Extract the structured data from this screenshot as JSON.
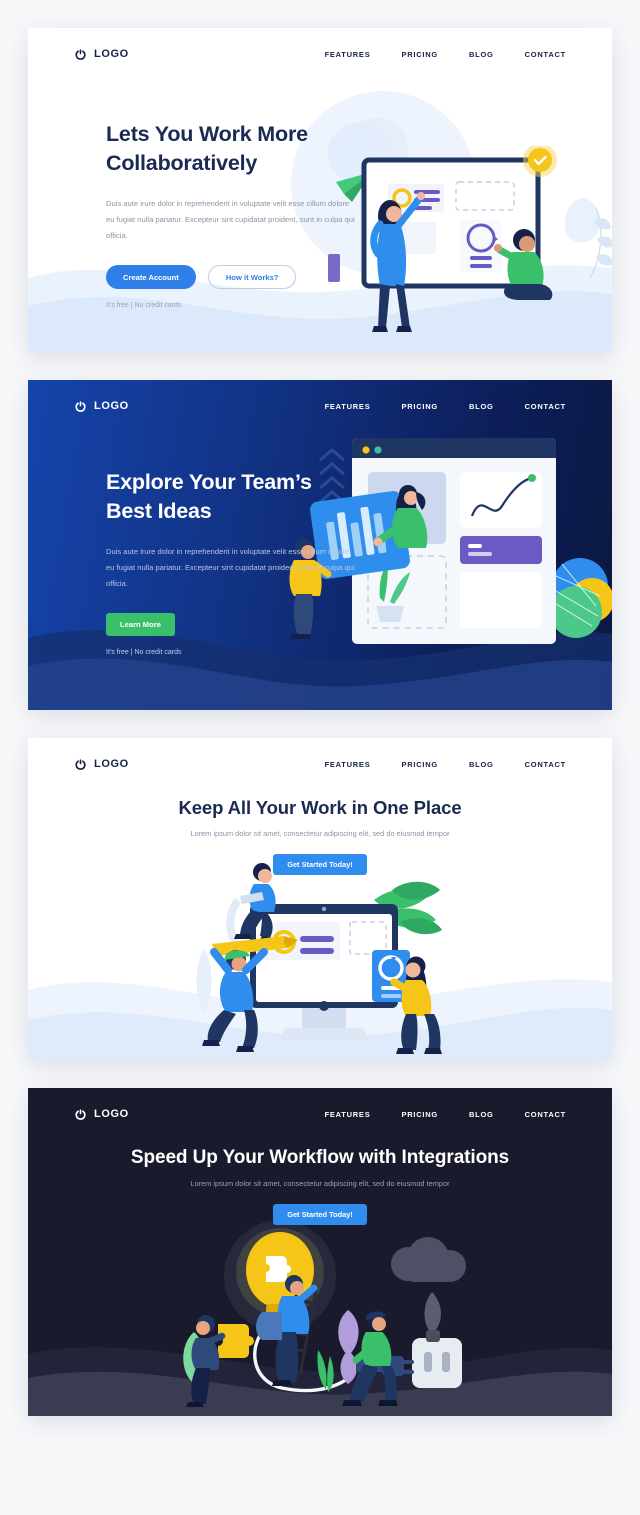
{
  "brand": {
    "name": "LOGO",
    "icon": "power-refresh-icon"
  },
  "nav": {
    "items": [
      {
        "label": "FEATURES"
      },
      {
        "label": "PRICING"
      },
      {
        "label": "BLOG"
      },
      {
        "label": "CONTACT"
      }
    ]
  },
  "colors": {
    "primary_blue": "#2f7fe8",
    "bright_blue": "#2f8ded",
    "green": "#3ac06a",
    "navy": "#1b2a52",
    "dark_bg": "#191a2b",
    "page_bg": "#f7f8fa",
    "purple": "#6c5ac4",
    "yellow": "#f5c518"
  },
  "sections": [
    {
      "id": "hero-collaborate",
      "heading": "Lets You Work More Collaboratively",
      "paragraph": "Duis aute irure dolor in reprehenderit in voluptate velit esse cillum dolore eu fugiat nulla pariatur. Excepteur sint cupidatat proident, sunt in culpa qui officia.",
      "primary_button": "Create Account",
      "secondary_button": "How it Works?",
      "fineprint": "It's free | No credit cards"
    },
    {
      "id": "hero-explore",
      "heading": "Explore Your Team’s Best Ideas",
      "paragraph": "Duis aute irure dolor in reprehenderit in voluptate velit esse cillum dolore eu fugiat nulla pariatur. Excepteur sint cupidatat proident, sunt in culpa qui officia.",
      "primary_button": "Learn More",
      "fineprint": "It's free | No credit cards"
    },
    {
      "id": "hero-one-place",
      "heading": "Keep All Your Work in One Place",
      "subheading": "Lorem ipsum dolor sit amet, consectetur adipiscing elit, sed do eiusmod tempor",
      "primary_button": "Get Started Today!"
    },
    {
      "id": "hero-integrations",
      "heading": "Speed Up Your Workflow with Integrations",
      "subheading": "Lorem ipsum dolor sit amet, consectetur adipiscing elit, sed do eiusmod tempor",
      "primary_button": "Get Started Today!"
    }
  ]
}
